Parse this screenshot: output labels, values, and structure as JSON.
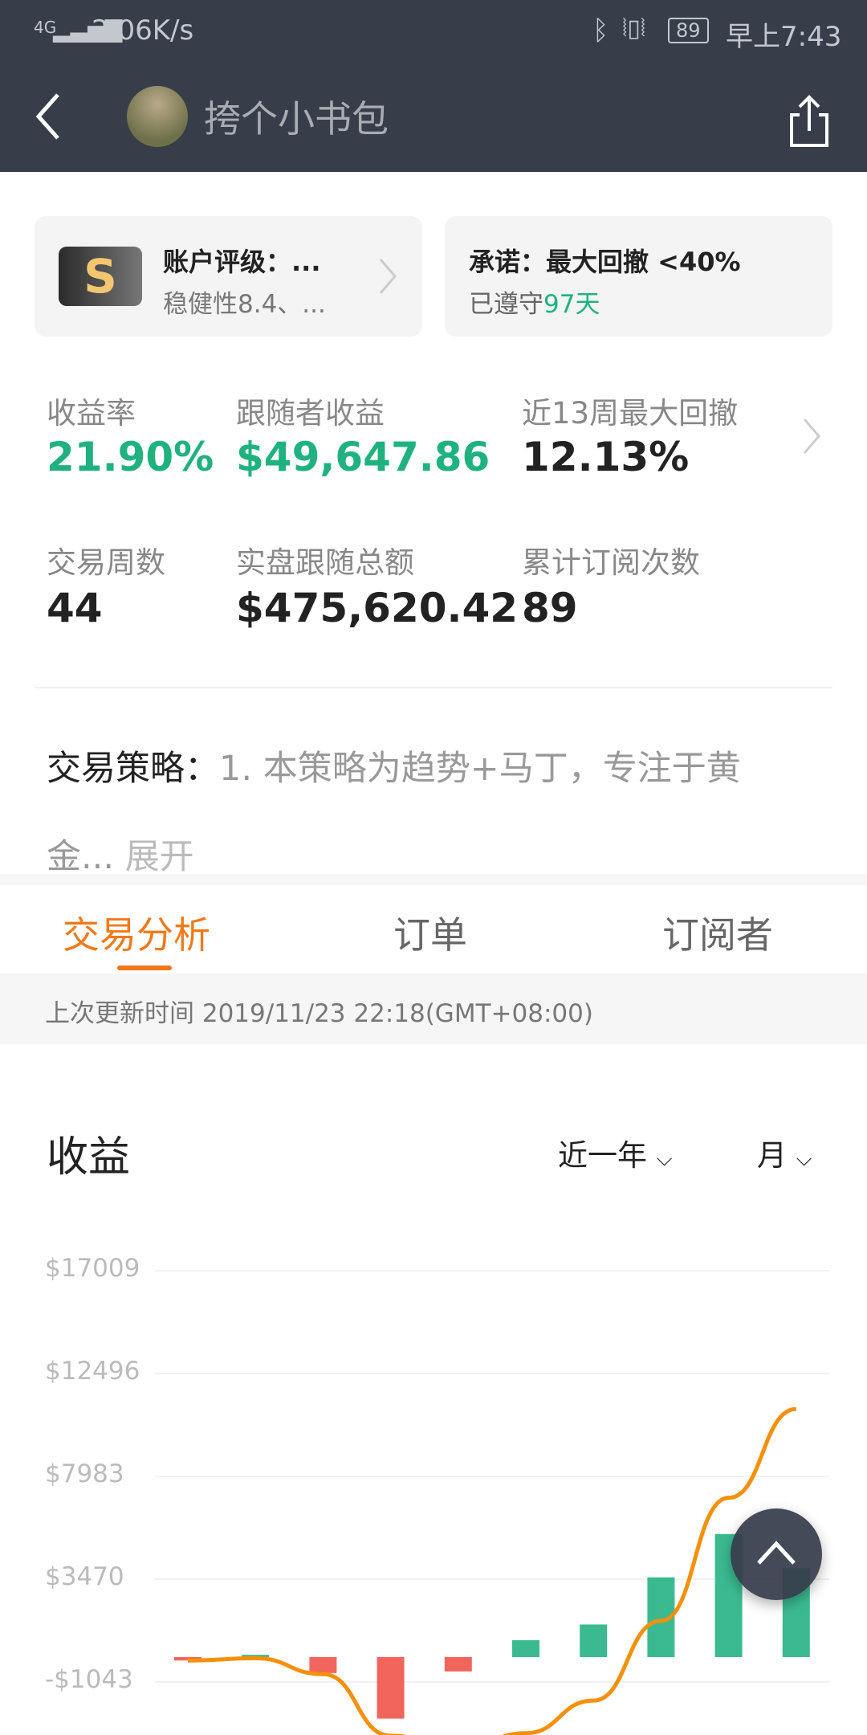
{
  "status_bar": {
    "network": "4G",
    "speed": "2.06K/s",
    "battery": "89",
    "time": "早上7:43"
  },
  "header": {
    "title": "挎个小书包"
  },
  "rating_card": {
    "badge": "S",
    "title": "账户评级：...",
    "subtitle": "稳健性8.4、..."
  },
  "promise_card": {
    "title": "承诺：最大回撤 <40%",
    "kept_prefix": "已遵守",
    "kept_days": "97天"
  },
  "stats": [
    {
      "label": "收益率",
      "value": "21.90%"
    },
    {
      "label": "跟随者收益",
      "value": "$49,647.86"
    },
    {
      "label": "近13周最大回撤",
      "value": "12.13%"
    },
    {
      "label": "交易周数",
      "value": "44"
    },
    {
      "label": "实盘跟随总额",
      "value": "$475,620.42"
    },
    {
      "label": "累计订阅次数",
      "value": "89"
    }
  ],
  "strategy": {
    "label": "交易策略：",
    "text": "1. 本策略为趋势+马丁，专注于黄",
    "text2": "金...",
    "expand": "展开"
  },
  "tabs": [
    {
      "label": "交易分析",
      "active": true
    },
    {
      "label": "订单"
    },
    {
      "label": "订阅者"
    }
  ],
  "update_time": "上次更新时间 2019/11/23 22:18(GMT+08:00)",
  "chart_section": {
    "title": "收益",
    "period": "近一年",
    "granularity": "月"
  },
  "colors": {
    "header": "#373e4a",
    "green": "#1fb27f",
    "accent": "#f07a1a",
    "bar_pos": "#3bba91",
    "bar_neg": "#f2655c",
    "line": "#f5900a"
  },
  "chart_data": {
    "type": "bar",
    "yticks": [
      "$17009",
      "$12496",
      "$7983",
      "$3470",
      "-$1043"
    ],
    "ytick_values": [
      17009,
      12496,
      7983,
      3470,
      -1043
    ],
    "bars": [
      -150,
      100,
      -700,
      -2700,
      -630,
      740,
      1430,
      3500,
      5400,
      3900
    ],
    "line": [
      -150,
      -50,
      -750,
      -3450,
      -4080,
      -3340,
      -1910,
      1590,
      6990,
      10890
    ],
    "grid": true
  }
}
